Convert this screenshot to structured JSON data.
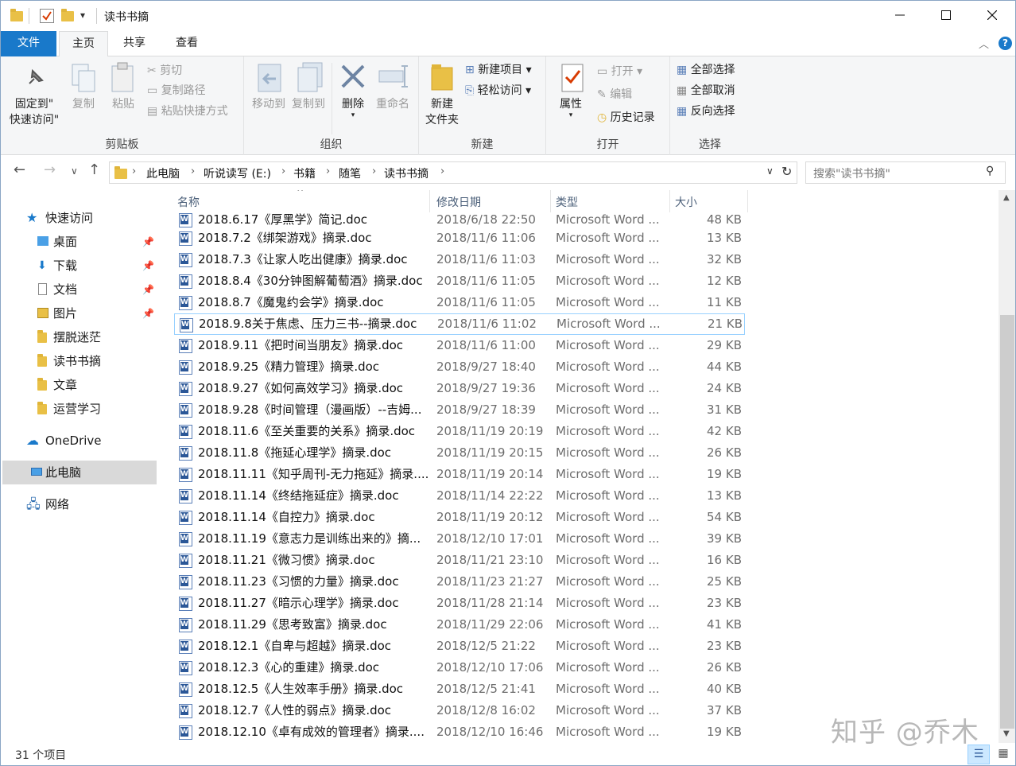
{
  "window": {
    "title": "读书书摘"
  },
  "tabs": {
    "file": "文件",
    "home": "主页",
    "share": "共享",
    "view": "查看"
  },
  "ribbon": {
    "clipboard": {
      "label": "剪贴板",
      "pin": "固定到\"",
      "pin2": "快速访问\"",
      "copy": "复制",
      "paste": "粘贴",
      "cut": "剪切",
      "copy_path": "复制路径",
      "paste_shortcut": "粘贴快捷方式"
    },
    "organize": {
      "label": "组织",
      "move_to": "移动到",
      "copy_to": "复制到",
      "delete": "删除",
      "rename": "重命名"
    },
    "new": {
      "label": "新建",
      "new_folder": "新建",
      "new_folder2": "文件夹",
      "new_item": "新建项目",
      "easy_access": "轻松访问"
    },
    "open": {
      "label": "打开",
      "properties": "属性",
      "open": "打开",
      "edit": "编辑",
      "history": "历史记录"
    },
    "select": {
      "label": "选择",
      "select_all": "全部选择",
      "select_none": "全部取消",
      "invert": "反向选择"
    }
  },
  "address": {
    "crumbs": [
      "此电脑",
      "听说读写 (E:)",
      "书籍",
      "随笔",
      "读书书摘"
    ],
    "search_placeholder": "搜索\"读书书摘\""
  },
  "nav": {
    "quick_access": "快速访问",
    "items": [
      "桌面",
      "下载",
      "文档",
      "图片",
      "摆脱迷茫",
      "读书书摘",
      "文章",
      "运营学习"
    ],
    "onedrive": "OneDrive",
    "this_pc": "此电脑",
    "network": "网络"
  },
  "columns": {
    "name": "名称",
    "date": "修改日期",
    "type": "类型",
    "size": "大小"
  },
  "files": [
    {
      "name": "2018.6.17《厚黑学》简记.doc",
      "date": "2018/6/18 22:50",
      "type": "Microsoft Word ...",
      "size": "48 KB"
    },
    {
      "name": "2018.7.2《绑架游戏》摘录.doc",
      "date": "2018/11/6 11:06",
      "type": "Microsoft Word ...",
      "size": "13 KB"
    },
    {
      "name": "2018.7.3《让家人吃出健康》摘录.doc",
      "date": "2018/11/6 11:03",
      "type": "Microsoft Word ...",
      "size": "32 KB"
    },
    {
      "name": "2018.8.4《30分钟图解葡萄酒》摘录.doc",
      "date": "2018/11/6 11:05",
      "type": "Microsoft Word ...",
      "size": "12 KB"
    },
    {
      "name": "2018.8.7《魔鬼约会学》摘录.doc",
      "date": "2018/11/6 11:05",
      "type": "Microsoft Word ...",
      "size": "11 KB"
    },
    {
      "name": "2018.9.8关于焦虑、压力三书--摘录.doc",
      "date": "2018/11/6 11:02",
      "type": "Microsoft Word ...",
      "size": "21 KB"
    },
    {
      "name": "2018.9.11《把时间当朋友》摘录.doc",
      "date": "2018/11/6 11:00",
      "type": "Microsoft Word ...",
      "size": "29 KB"
    },
    {
      "name": "2018.9.25《精力管理》摘录.doc",
      "date": "2018/9/27 18:40",
      "type": "Microsoft Word ...",
      "size": "44 KB"
    },
    {
      "name": "2018.9.27《如何高效学习》摘录.doc",
      "date": "2018/9/27 19:36",
      "type": "Microsoft Word ...",
      "size": "24 KB"
    },
    {
      "name": "2018.9.28《时间管理（漫画版）--吉姆...",
      "date": "2018/9/27 18:39",
      "type": "Microsoft Word ...",
      "size": "31 KB"
    },
    {
      "name": "2018.11.6《至关重要的关系》摘录.doc",
      "date": "2018/11/19 20:19",
      "type": "Microsoft Word ...",
      "size": "42 KB"
    },
    {
      "name": "2018.11.8《拖延心理学》摘录.doc",
      "date": "2018/11/19 20:15",
      "type": "Microsoft Word ...",
      "size": "26 KB"
    },
    {
      "name": "2018.11.11《知乎周刊-无力拖延》摘录....",
      "date": "2018/11/19 20:14",
      "type": "Microsoft Word ...",
      "size": "19 KB"
    },
    {
      "name": "2018.11.14《终结拖延症》摘录.doc",
      "date": "2018/11/14 22:22",
      "type": "Microsoft Word ...",
      "size": "13 KB"
    },
    {
      "name": "2018.11.14《自控力》摘录.doc",
      "date": "2018/11/19 20:12",
      "type": "Microsoft Word ...",
      "size": "54 KB"
    },
    {
      "name": "2018.11.19《意志力是训练出来的》摘...",
      "date": "2018/12/10 17:01",
      "type": "Microsoft Word ...",
      "size": "39 KB"
    },
    {
      "name": "2018.11.21《微习惯》摘录.doc",
      "date": "2018/11/21 23:10",
      "type": "Microsoft Word ...",
      "size": "16 KB"
    },
    {
      "name": "2018.11.23《习惯的力量》摘录.doc",
      "date": "2018/11/23 21:27",
      "type": "Microsoft Word ...",
      "size": "25 KB"
    },
    {
      "name": "2018.11.27《暗示心理学》摘录.doc",
      "date": "2018/11/28 21:14",
      "type": "Microsoft Word ...",
      "size": "23 KB"
    },
    {
      "name": "2018.11.29《思考致富》摘录.doc",
      "date": "2018/11/29 22:06",
      "type": "Microsoft Word ...",
      "size": "41 KB"
    },
    {
      "name": "2018.12.1《自卑与超越》摘录.doc",
      "date": "2018/12/5 21:22",
      "type": "Microsoft Word ...",
      "size": "23 KB"
    },
    {
      "name": "2018.12.3《心的重建》摘录.doc",
      "date": "2018/12/10 17:06",
      "type": "Microsoft Word ...",
      "size": "26 KB"
    },
    {
      "name": "2018.12.5《人生效率手册》摘录.doc",
      "date": "2018/12/5 21:41",
      "type": "Microsoft Word ...",
      "size": "40 KB"
    },
    {
      "name": "2018.12.7《人性的弱点》摘录.doc",
      "date": "2018/12/8 16:02",
      "type": "Microsoft Word ...",
      "size": "37 KB"
    },
    {
      "name": "2018.12.10《卓有成效的管理者》摘录....",
      "date": "2018/12/10 16:46",
      "type": "Microsoft Word ...",
      "size": "19 KB"
    }
  ],
  "status": {
    "count": "31 个项目"
  },
  "watermark": "知乎 @乔木"
}
